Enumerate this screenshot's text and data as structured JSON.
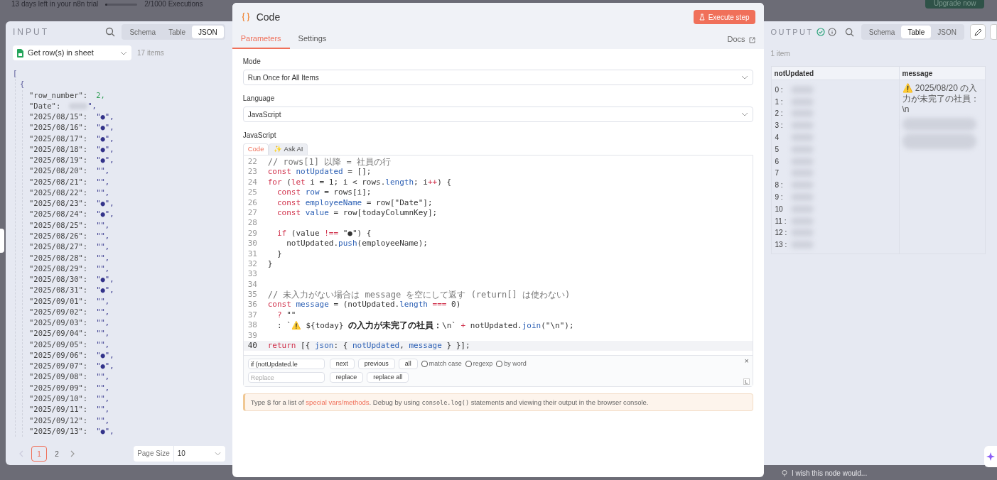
{
  "background": {
    "trial_text": "13 days left in your n8n trial",
    "executions_usage": {
      "level": 0.05
    },
    "executions": "2/1000 Executions",
    "upgrade": "Upgrade now",
    "feedback": "I wish this node would..."
  },
  "input": {
    "title": "INPUT",
    "views": [
      {
        "label": "Schema",
        "selected": false
      },
      {
        "label": "Table",
        "selected": false
      },
      {
        "label": "JSON",
        "selected": true
      }
    ],
    "source": "Get row(s) in sheet",
    "count": "17 items",
    "open": [
      "[",
      "{"
    ],
    "entries": [
      {
        "key": "\"row_number\":",
        "value": "2",
        "tail": ",",
        "kind": "number"
      },
      {
        "key": "\"Date\":",
        "value": "\"",
        "tail": ",",
        "kind": "redacted"
      },
      {
        "key": "\"2025/08/15\":",
        "value": "\"●\"",
        "tail": ",",
        "kind": "string"
      },
      {
        "key": "\"2025/08/16\":",
        "value": "\"●\"",
        "tail": ",",
        "kind": "string"
      },
      {
        "key": "\"2025/08/17\":",
        "value": "\"●\"",
        "tail": ",",
        "kind": "string"
      },
      {
        "key": "\"2025/08/18\":",
        "value": "\"●\"",
        "tail": ",",
        "kind": "string"
      },
      {
        "key": "\"2025/08/19\":",
        "value": "\"●\"",
        "tail": ",",
        "kind": "string"
      },
      {
        "key": "\"2025/08/20\":",
        "value": "\"\"",
        "tail": ",",
        "kind": "string"
      },
      {
        "key": "\"2025/08/21\":",
        "value": "\"\"",
        "tail": ",",
        "kind": "string"
      },
      {
        "key": "\"2025/08/22\":",
        "value": "\"\"",
        "tail": ",",
        "kind": "string"
      },
      {
        "key": "\"2025/08/23\":",
        "value": "\"●\"",
        "tail": ",",
        "kind": "string"
      },
      {
        "key": "\"2025/08/24\":",
        "value": "\"●\"",
        "tail": ",",
        "kind": "string"
      },
      {
        "key": "\"2025/08/25\":",
        "value": "\"\"",
        "tail": ",",
        "kind": "string"
      },
      {
        "key": "\"2025/08/26\":",
        "value": "\"\"",
        "tail": ",",
        "kind": "string"
      },
      {
        "key": "\"2025/08/27\":",
        "value": "\"\"",
        "tail": ",",
        "kind": "string"
      },
      {
        "key": "\"2025/08/28\":",
        "value": "\"\"",
        "tail": ",",
        "kind": "string"
      },
      {
        "key": "\"2025/08/29\":",
        "value": "\"\"",
        "tail": ",",
        "kind": "string"
      },
      {
        "key": "\"2025/08/30\":",
        "value": "\"●\"",
        "tail": ",",
        "kind": "string"
      },
      {
        "key": "\"2025/08/31\":",
        "value": "\"●\"",
        "tail": ",",
        "kind": "string"
      },
      {
        "key": "\"2025/09/01\":",
        "value": "\"\"",
        "tail": ",",
        "kind": "string"
      },
      {
        "key": "\"2025/09/02\":",
        "value": "\"\"",
        "tail": ",",
        "kind": "string"
      },
      {
        "key": "\"2025/09/03\":",
        "value": "\"\"",
        "tail": ",",
        "kind": "string"
      },
      {
        "key": "\"2025/09/04\":",
        "value": "\"\"",
        "tail": ",",
        "kind": "string"
      },
      {
        "key": "\"2025/09/05\":",
        "value": "\"\"",
        "tail": ",",
        "kind": "string"
      },
      {
        "key": "\"2025/09/06\":",
        "value": "\"●\"",
        "tail": ",",
        "kind": "string"
      },
      {
        "key": "\"2025/09/07\":",
        "value": "\"●\"",
        "tail": ",",
        "kind": "string"
      },
      {
        "key": "\"2025/09/08\":",
        "value": "\"\"",
        "tail": ",",
        "kind": "string"
      },
      {
        "key": "\"2025/09/09\":",
        "value": "\"\"",
        "tail": ",",
        "kind": "string"
      },
      {
        "key": "\"2025/09/10\":",
        "value": "\"\"",
        "tail": ",",
        "kind": "string"
      },
      {
        "key": "\"2025/09/11\":",
        "value": "\"\"",
        "tail": ",",
        "kind": "string"
      },
      {
        "key": "\"2025/09/12\":",
        "value": "\"\"",
        "tail": ",",
        "kind": "string"
      },
      {
        "key": "\"2025/09/13\":",
        "value": "\"●\"",
        "tail": ",",
        "kind": "string"
      }
    ],
    "pages": [
      {
        "label": "1",
        "selected": true
      },
      {
        "label": "2",
        "selected": false
      }
    ],
    "page_size_label": "Page Size",
    "page_size": "10"
  },
  "node": {
    "title": "Code",
    "execute": "Execute step",
    "tabs": [
      {
        "label": "Parameters",
        "selected": true
      },
      {
        "label": "Settings",
        "selected": false
      }
    ],
    "docs": "Docs",
    "mode_label": "Mode",
    "mode": "Run Once for All Items",
    "language_label": "Language",
    "language": "JavaScript",
    "code_label": "JavaScript",
    "editor_tabs": [
      {
        "label": "Code",
        "selected": true
      },
      {
        "label": "✨ Ask AI",
        "selected": false
      }
    ],
    "lines": [
      {
        "number": "22",
        "active": false,
        "tokens": [
          {
            "t": "// rows[1] 以降 = 社員の行",
            "kind": "comment"
          }
        ]
      },
      {
        "number": "23",
        "active": false,
        "tokens": [
          {
            "t": "const ",
            "kind": "kw"
          },
          {
            "t": "notUpdated",
            "kind": "var"
          },
          {
            "t": " = [];",
            "kind": "plain"
          }
        ]
      },
      {
        "number": "24",
        "active": false,
        "tokens": [
          {
            "t": "for ",
            "kind": "kw"
          },
          {
            "t": "(",
            "kind": "plain"
          },
          {
            "t": "let ",
            "kind": "kw"
          },
          {
            "t": "i = 1; i < rows.",
            "kind": "plain"
          },
          {
            "t": "length",
            "kind": "var"
          },
          {
            "t": "; i",
            "kind": "plain"
          },
          {
            "t": "++",
            "kind": "kw"
          },
          {
            "t": ") {",
            "kind": "plain"
          }
        ]
      },
      {
        "number": "25",
        "active": false,
        "tokens": [
          {
            "t": "  const ",
            "kind": "kw"
          },
          {
            "t": "row",
            "kind": "var"
          },
          {
            "t": " = rows[i];",
            "kind": "plain"
          }
        ]
      },
      {
        "number": "26",
        "active": false,
        "tokens": [
          {
            "t": "  const ",
            "kind": "kw"
          },
          {
            "t": "employeeName",
            "kind": "var"
          },
          {
            "t": " = row[\"Date\"];",
            "kind": "plain"
          }
        ]
      },
      {
        "number": "27",
        "active": false,
        "tokens": [
          {
            "t": "  const ",
            "kind": "kw"
          },
          {
            "t": "value",
            "kind": "var"
          },
          {
            "t": " = row[todayColumnKey];",
            "kind": "plain"
          }
        ]
      },
      {
        "number": "28",
        "active": false
      },
      {
        "number": "29",
        "active": false,
        "tokens": [
          {
            "t": "  if ",
            "kind": "kw"
          },
          {
            "t": "(value ",
            "kind": "plain"
          },
          {
            "t": "!==",
            "kind": "kw"
          },
          {
            "t": " \"●\") {",
            "kind": "plain"
          }
        ]
      },
      {
        "number": "30",
        "active": false,
        "tokens": [
          {
            "t": "    notUpdated.",
            "kind": "plain"
          },
          {
            "t": "push",
            "kind": "var"
          },
          {
            "t": "(employeeName);",
            "kind": "plain"
          }
        ]
      },
      {
        "number": "31",
        "active": false,
        "tokens": [
          {
            "t": "  }",
            "kind": "plain"
          }
        ]
      },
      {
        "number": "32",
        "active": false,
        "tokens": [
          {
            "t": "}",
            "kind": "plain"
          }
        ]
      },
      {
        "number": "33",
        "active": false
      },
      {
        "number": "34",
        "active": false
      },
      {
        "number": "35",
        "active": false,
        "tokens": [
          {
            "t": "// 未入力がない場合は message を空にして返す (return[] は使わない)",
            "kind": "comment"
          }
        ]
      },
      {
        "number": "36",
        "active": false,
        "tokens": [
          {
            "t": "const ",
            "kind": "kw"
          },
          {
            "t": "message",
            "kind": "var"
          },
          {
            "t": " = (notUpdated.",
            "kind": "plain"
          },
          {
            "t": "length",
            "kind": "var"
          },
          {
            "t": " ===",
            "kind": "kw"
          },
          {
            "t": " 0)",
            "kind": "plain"
          }
        ]
      },
      {
        "number": "37",
        "active": false,
        "tokens": [
          {
            "t": "  ?",
            "kind": "kw"
          },
          {
            "t": " \"\"",
            "kind": "plain"
          }
        ]
      },
      {
        "number": "38",
        "active": false,
        "tokens": [
          {
            "t": "  : `⚠️ ${today} ",
            "kind": "plain"
          },
          {
            "t": "の入力が未完了の社員：",
            "kind": "bold"
          },
          {
            "t": "\\n` ",
            "kind": "plain"
          },
          {
            "t": "+",
            "kind": "kw"
          },
          {
            "t": " notUpdated.",
            "kind": "plain"
          },
          {
            "t": "join",
            "kind": "var"
          },
          {
            "t": "(\"\\n\");",
            "kind": "plain"
          }
        ]
      },
      {
        "number": "39",
        "active": false
      },
      {
        "number": "40",
        "active": true,
        "tokens": [
          {
            "t": "return ",
            "kind": "kw"
          },
          {
            "t": "[{ ",
            "kind": "plain"
          },
          {
            "t": "json",
            "kind": "var"
          },
          {
            "t": ": { ",
            "kind": "plain"
          },
          {
            "t": "notUpdated",
            "kind": "var"
          },
          {
            "t": ", ",
            "kind": "plain"
          },
          {
            "t": "message",
            "kind": "var"
          },
          {
            "t": " } }];",
            "kind": "plain"
          }
        ]
      }
    ],
    "search": {
      "find_value": "if (notUpdated.le",
      "buttons": [
        "next",
        "previous",
        "all"
      ],
      "options": [
        {
          "label": "match case",
          "checked": false
        },
        {
          "label": "regexp",
          "checked": false
        },
        {
          "label": "by word",
          "checked": false
        }
      ],
      "replace_placeholder": "Replace",
      "replace_buttons": [
        "replace",
        "replace all"
      ],
      "close": "×"
    },
    "hint": {
      "before": "Type $ for a list of ",
      "link": "special vars/methods",
      "middle": ". Debug by using ",
      "code": "console.log()",
      "after": " statements and viewing their output in the browser console."
    }
  },
  "output": {
    "title": "OUTPUT",
    "views": [
      {
        "label": "Schema",
        "selected": false
      },
      {
        "label": "Table",
        "selected": true
      },
      {
        "label": "JSON",
        "selected": false
      }
    ],
    "count": "1 item",
    "columns": [
      "notUpdated",
      "message"
    ],
    "indices": [
      "0 :",
      "1 :",
      "2 :",
      "3 :",
      "4",
      "5",
      "6",
      "7",
      "8 :",
      "9 :",
      "10",
      "11 :",
      "12 :",
      "13 :"
    ],
    "message": "⚠️ 2025/08/20 の入力が未完了の社員：\\n"
  }
}
